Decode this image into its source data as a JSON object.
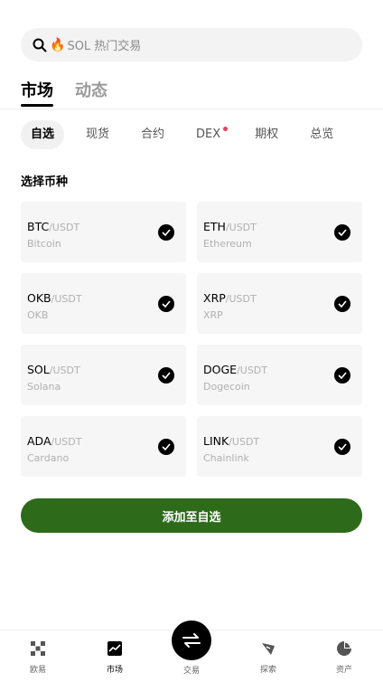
{
  "search": {
    "placeholder": "SOL 热门交易",
    "fire": "🔥"
  },
  "main_tabs": [
    {
      "label": "市场",
      "active": true
    },
    {
      "label": "动态",
      "active": false
    }
  ],
  "sub_tabs": [
    {
      "label": "自选",
      "active": true
    },
    {
      "label": "现货"
    },
    {
      "label": "合约"
    },
    {
      "label": "DEX",
      "dot": true
    },
    {
      "label": "期权"
    },
    {
      "label": "总览"
    }
  ],
  "section_title": "选择币种",
  "coins": [
    {
      "symbol": "BTC",
      "quote": "/USDT",
      "name": "Bitcoin",
      "checked": true
    },
    {
      "symbol": "ETH",
      "quote": "/USDT",
      "name": "Ethereum",
      "checked": true
    },
    {
      "symbol": "OKB",
      "quote": "/USDT",
      "name": "OKB",
      "checked": true
    },
    {
      "symbol": "XRP",
      "quote": "/USDT",
      "name": "XRP",
      "checked": true
    },
    {
      "symbol": "SOL",
      "quote": "/USDT",
      "name": "Solana",
      "checked": true
    },
    {
      "symbol": "DOGE",
      "quote": "/USDT",
      "name": "Dogecoin",
      "checked": true
    },
    {
      "symbol": "ADA",
      "quote": "/USDT",
      "name": "Cardano",
      "checked": true
    },
    {
      "symbol": "LINK",
      "quote": "/USDT",
      "name": "Chainlink",
      "checked": true
    }
  ],
  "add_button": "添加至自选",
  "bottom_nav": [
    {
      "label": "欧易",
      "icon": "okx-logo-icon"
    },
    {
      "label": "市场",
      "icon": "market-chart-icon",
      "active": true
    },
    {
      "label": "交易",
      "icon": "swap-arrows-icon"
    },
    {
      "label": "探索",
      "icon": "compass-icon"
    },
    {
      "label": "资产",
      "icon": "pie-chart-icon"
    }
  ],
  "colors": {
    "accent": "#2d6a1a",
    "dot": "#e5405e"
  }
}
